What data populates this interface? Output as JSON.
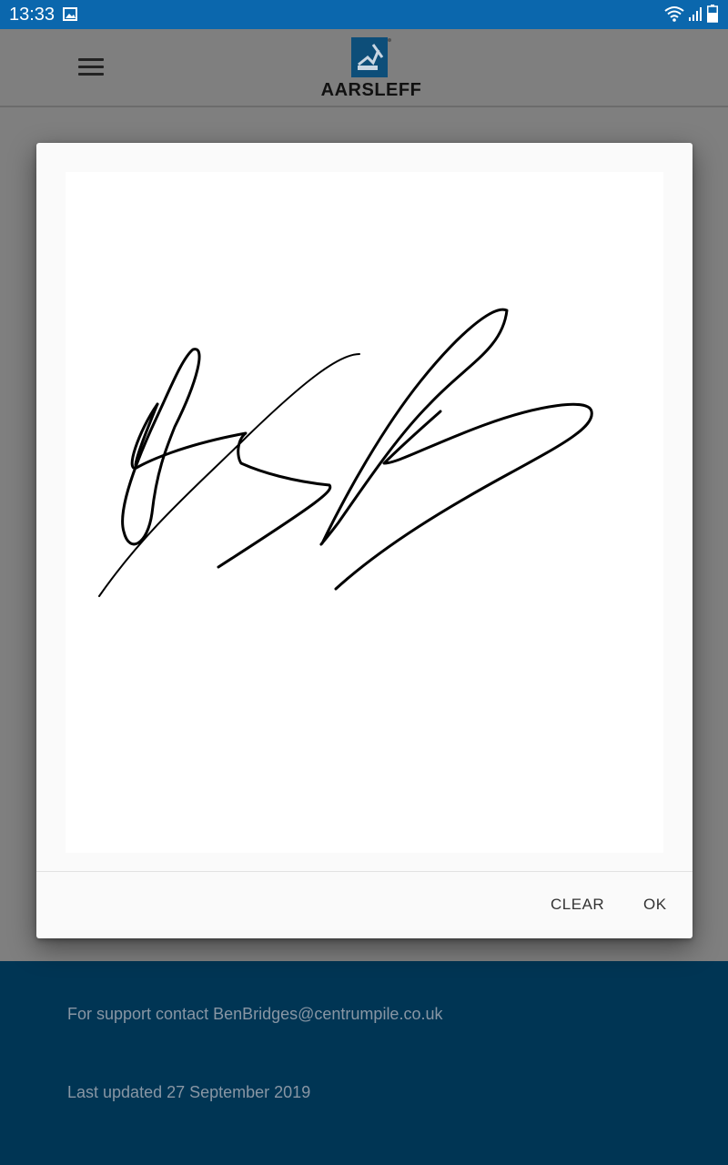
{
  "status_bar": {
    "time": "13:33",
    "icons": [
      "image-icon",
      "wifi-icon",
      "signal-icon",
      "battery-icon"
    ]
  },
  "header": {
    "menu_icon": "hamburger-menu-icon",
    "logo_text": "AARSLEFF",
    "brand_color": "#0b5a8f"
  },
  "dialog": {
    "clear_label": "CLEAR",
    "ok_label": "OK"
  },
  "footer": {
    "support_text": "For support contact BenBridges@centrumpile.co.uk",
    "updated_text": "Last updated 27 September 2019",
    "background_color": "#003554"
  }
}
